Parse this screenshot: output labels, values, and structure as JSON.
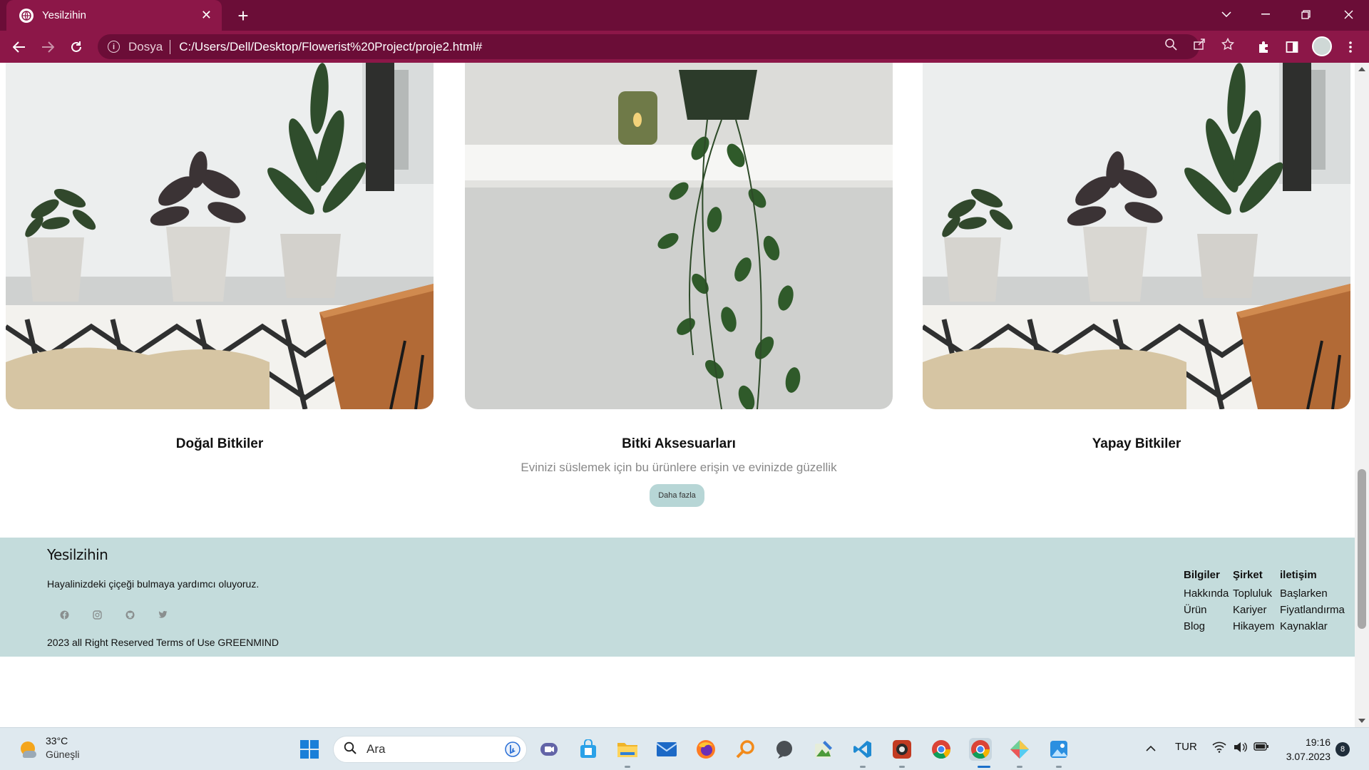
{
  "browser": {
    "tab_title": "Yesilzihin",
    "new_tab_label": "+",
    "scheme_label": "Dosya",
    "url": "C:/Users/Dell/Desktop/Flowerist%20Project/proje2.html#"
  },
  "page": {
    "cards": [
      {
        "title": "Doğal Bitkiler"
      },
      {
        "title": "Bitki Aksesuarları",
        "description": "Evinizi süslemek için bu ürünlere erişin ve evinizde güzellik",
        "button": "Daha fazla"
      },
      {
        "title": "Yapay Bitkiler"
      }
    ],
    "footer": {
      "brand": "Yesilzihin",
      "tagline": "Hayalinizdeki çiçeği bulmaya yardımcı oluyoruz.",
      "copyright": "2023 all Right Reserved Terms of Use GREENMIND",
      "social_icons": [
        "facebook-icon",
        "instagram-icon",
        "github-icon",
        "twitter-icon"
      ],
      "columns": [
        {
          "heading": "Bilgiler",
          "items": [
            "Hakkında",
            "Ürün",
            "Blog"
          ]
        },
        {
          "heading": "Şirket",
          "items": [
            "Topluluk",
            "Kariyer",
            "Hikayem"
          ]
        },
        {
          "heading": "iletişim",
          "items": [
            "Başlarken",
            "Fiyatlandırma",
            "Kaynaklar"
          ]
        }
      ]
    }
  },
  "taskbar": {
    "weather_temp": "33°C",
    "weather_condition": "Güneşli",
    "search_placeholder": "Ara",
    "language": "TUR",
    "time": "19:16",
    "date": "3.07.2023",
    "notification_count": "8"
  },
  "colors": {
    "browser_frame": "#6b0d37",
    "toolbar": "#8c1748",
    "footer_bg": "#c4dcdc",
    "button_bg": "#b7d6d6"
  }
}
